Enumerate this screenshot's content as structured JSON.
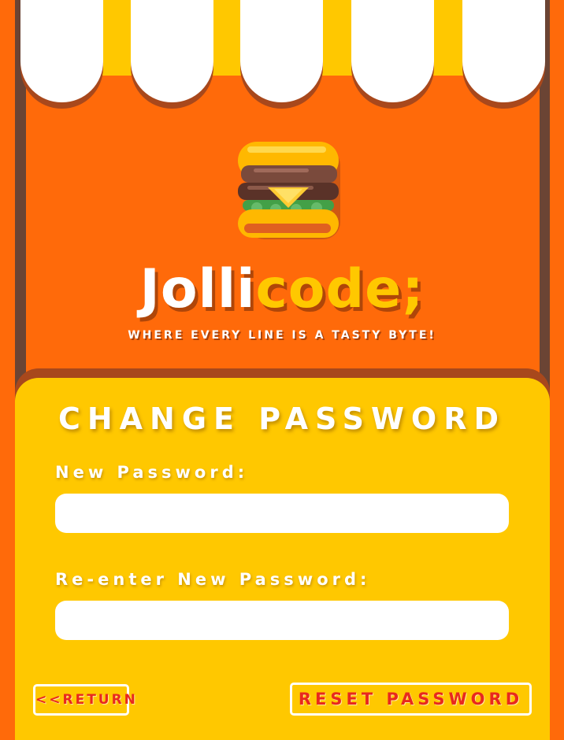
{
  "brand": {
    "name_part1": "Jolli",
    "name_part2": "code;",
    "tagline": "WHERE EVERY LINE IS A TASTY BYTE!",
    "logo_icon": "burger-icon"
  },
  "form": {
    "title": "CHANGE PASSWORD",
    "new_password_label": "New Password:",
    "new_password_value": "",
    "new_password_placeholder": "",
    "reenter_password_label": "Re-enter New Password:",
    "reenter_password_value": "",
    "reenter_password_placeholder": ""
  },
  "actions": {
    "return_label": "<<RETURN",
    "reset_label": "RESET PASSWORD"
  },
  "colors": {
    "background_orange": "#ff6a0a",
    "panel_yellow": "#ffc800",
    "frame_brown": "#6b4434",
    "button_text_red": "#e8281e",
    "awning_white": "#ffffff"
  }
}
